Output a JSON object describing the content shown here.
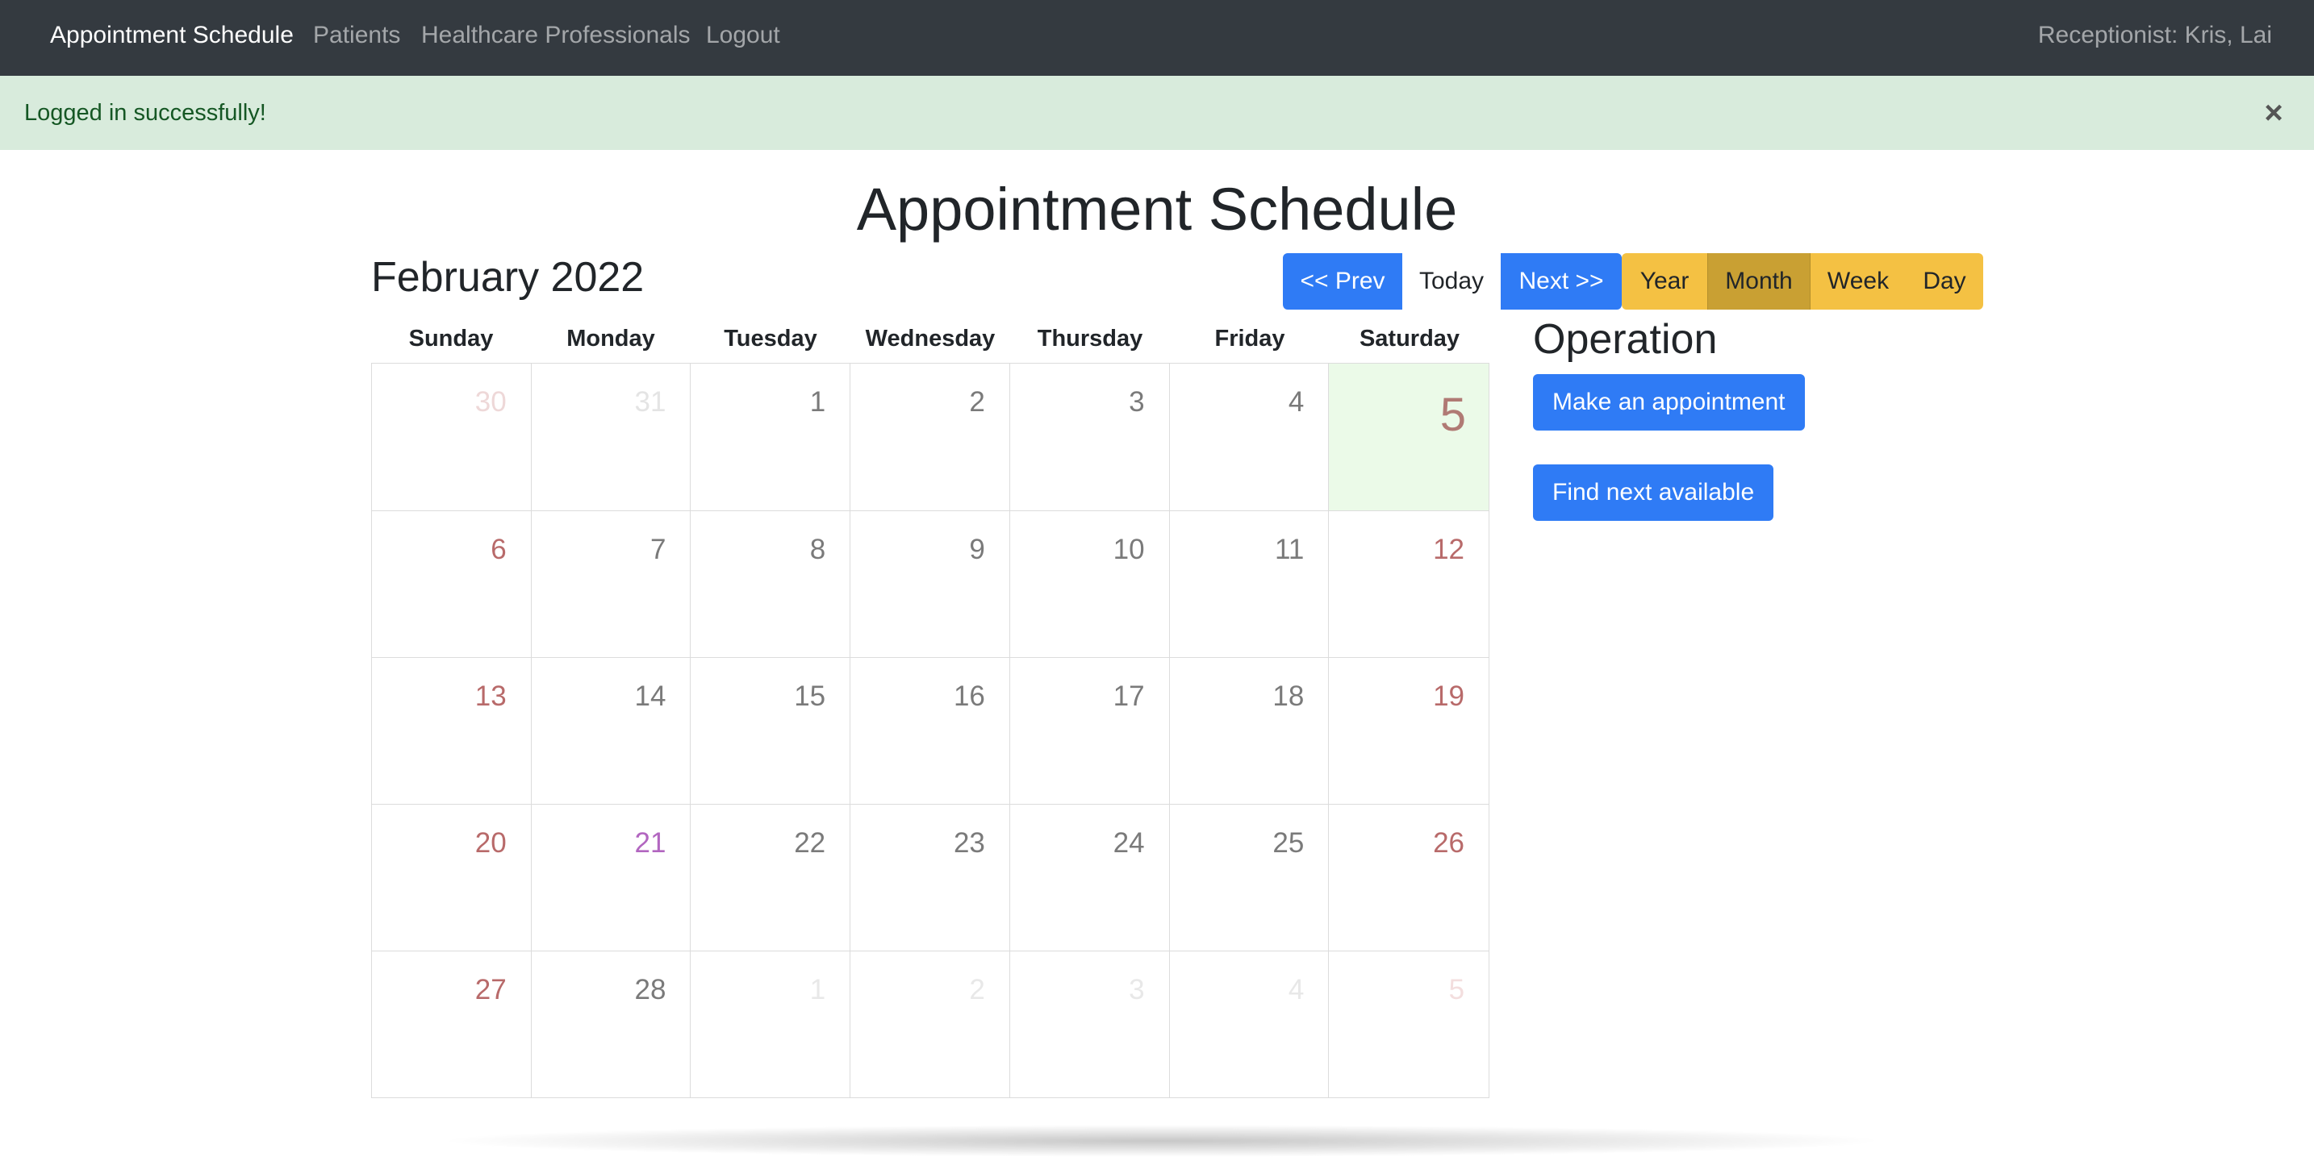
{
  "navbar": {
    "brand": "Appointment Schedule",
    "links": [
      "Patients",
      "Healthcare Professionals",
      "Logout"
    ],
    "user": "Receptionist: Kris, Lai"
  },
  "alert": {
    "message": "Logged in successfully!",
    "close": "×"
  },
  "page_title": "Appointment Schedule",
  "calendar": {
    "month_title": "February 2022",
    "toolbar": {
      "prev": "<< Prev",
      "today": "Today",
      "next": "Next >>",
      "views": [
        "Year",
        "Month",
        "Week",
        "Day"
      ],
      "active_view": "Month"
    },
    "weekdays": [
      "Sunday",
      "Monday",
      "Tuesday",
      "Wednesday",
      "Thursday",
      "Friday",
      "Saturday"
    ],
    "weeks": [
      [
        {
          "n": "30",
          "c": "#eed8d8"
        },
        {
          "n": "31",
          "c": "#e4e4e4"
        },
        {
          "n": "1",
          "c": "#7a7a7a"
        },
        {
          "n": "2",
          "c": "#7a7a7a"
        },
        {
          "n": "3",
          "c": "#7a7a7a"
        },
        {
          "n": "4",
          "c": "#7a7a7a"
        },
        {
          "n": "5",
          "c": "#b07a74",
          "today": true
        }
      ],
      [
        {
          "n": "6",
          "c": "#b86a6a"
        },
        {
          "n": "7",
          "c": "#7a7a7a"
        },
        {
          "n": "8",
          "c": "#7a7a7a"
        },
        {
          "n": "9",
          "c": "#7a7a7a"
        },
        {
          "n": "10",
          "c": "#7a7a7a"
        },
        {
          "n": "11",
          "c": "#7a7a7a"
        },
        {
          "n": "12",
          "c": "#b86a6a"
        }
      ],
      [
        {
          "n": "13",
          "c": "#b86a6a"
        },
        {
          "n": "14",
          "c": "#7a7a7a"
        },
        {
          "n": "15",
          "c": "#7a7a7a"
        },
        {
          "n": "16",
          "c": "#7a7a7a"
        },
        {
          "n": "17",
          "c": "#7a7a7a"
        },
        {
          "n": "18",
          "c": "#7a7a7a"
        },
        {
          "n": "19",
          "c": "#b86a6a"
        }
      ],
      [
        {
          "n": "20",
          "c": "#b86a6a"
        },
        {
          "n": "21",
          "c": "#b266c0"
        },
        {
          "n": "22",
          "c": "#7a7a7a"
        },
        {
          "n": "23",
          "c": "#7a7a7a"
        },
        {
          "n": "24",
          "c": "#7a7a7a"
        },
        {
          "n": "25",
          "c": "#7a7a7a"
        },
        {
          "n": "26",
          "c": "#b86a6a"
        }
      ],
      [
        {
          "n": "27",
          "c": "#b86a6a"
        },
        {
          "n": "28",
          "c": "#7a7a7a"
        },
        {
          "n": "1",
          "c": "#e8e8e8"
        },
        {
          "n": "2",
          "c": "#e8e8e8"
        },
        {
          "n": "3",
          "c": "#e8e8e8"
        },
        {
          "n": "4",
          "c": "#e8e8e8"
        },
        {
          "n": "5",
          "c": "#f3dede"
        }
      ]
    ]
  },
  "operation": {
    "title": "Operation",
    "make_appointment": "Make an appointment",
    "find_next": "Find next available"
  },
  "colors": {
    "navbar_bg": "#343a40",
    "alert_bg": "#d8ebdc",
    "primary": "#2f7bf5",
    "warning": "#f4c143",
    "warning_active": "#c9a033",
    "today_bg": "#ebfae8"
  }
}
